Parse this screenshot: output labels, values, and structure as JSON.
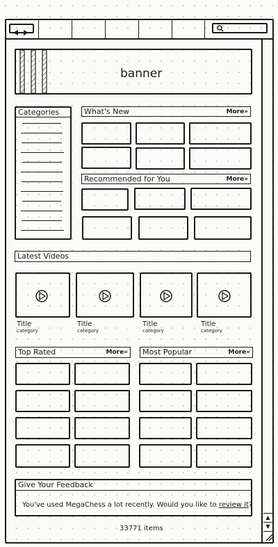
{
  "toolbar": {
    "back_icon": "triangle-left",
    "forward_icon": "triangle-right",
    "search_placeholder": ""
  },
  "banner": {
    "label": "banner"
  },
  "categories": {
    "title": "Categories",
    "item_count": 12
  },
  "whats_new": {
    "title": "What's New",
    "more": "More»"
  },
  "recommended": {
    "title": "Recommended for You",
    "more": "More»"
  },
  "latest_videos": {
    "title": "Latest Videos",
    "items": [
      {
        "title": "Title",
        "category": "category"
      },
      {
        "title": "Title",
        "category": "category"
      },
      {
        "title": "Title",
        "category": "category"
      },
      {
        "title": "Title",
        "category": "category"
      }
    ]
  },
  "top_rated": {
    "title": "Top Rated",
    "more": "More»"
  },
  "most_popular": {
    "title": "Most Popular",
    "more": "More»"
  },
  "feedback": {
    "title": "Give Your Feedback",
    "text": "You've used MegaChess a lot recently. Would you like to ",
    "link": "review it",
    "suffix": "?"
  },
  "status": {
    "items": "33771 items"
  },
  "scrollbar": {
    "up_icon": "▲",
    "down_icon": "▼",
    "grip_icon": "grip"
  }
}
